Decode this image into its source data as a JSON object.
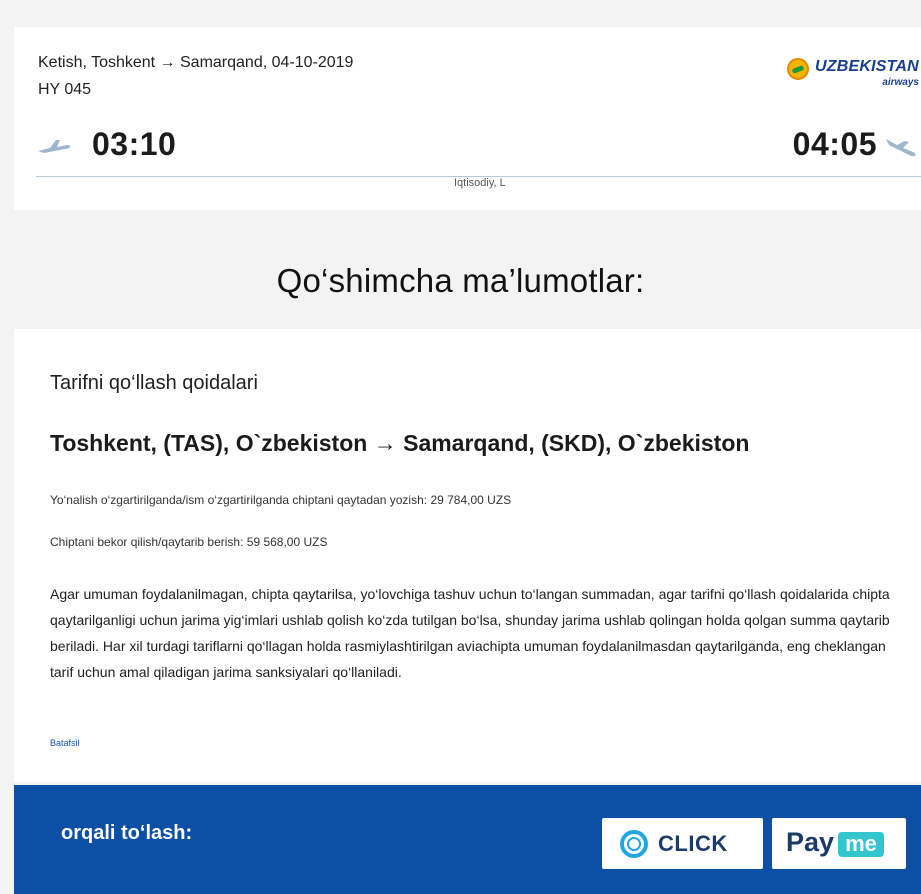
{
  "flight": {
    "route_title": "Ketish, Toshkent → Samarqand, 04-10-2019",
    "flight_number": "HY 045",
    "departure_time": "03:10",
    "arrival_time": "04:05",
    "fare_class": "Iqtisodiy, L",
    "airline": {
      "name": "UZBEKISTAN",
      "sub": "airways"
    }
  },
  "info": {
    "heading": "Qo‘shimcha ma’lumotlar:"
  },
  "rules": {
    "title": "Tarifni qo‘llash qoidalari",
    "route": "Toshkent, (TAS), O`zbekiston → Samarqand, (SKD), O`zbekiston",
    "change_fee": "Yo‘nalish o‘zgartirilganda/ism o‘zgartirilganda chiptani qaytadan yozish: 29 784,00 UZS",
    "cancel_fee": "Chiptani bekor qilish/qaytarib berish: 59 568,00 UZS",
    "paragraph": "Agar umuman foydalanilmagan, chipta qaytarilsa, yo‘lovchiga tashuv uchun to‘langan summadan, agar tarifni qo‘llash qoidalarida chipta qaytarilganligi uchun jarima yig‘imlari ushlab qolish ko‘zda tutilgan bo‘lsa, shunday jarima ushlab qolingan holda qolgan summa qaytarib beriladi. Har xil turdagi tariflarni qo‘llagan holda rasmiylashtirilgan aviachipta umuman foydalanilmasdan qaytarilganda, eng cheklangan tarif uchun amal qiladigan jarima sanksiyalari qo‘llaniladi.",
    "more_link": "Batafsil"
  },
  "payment": {
    "label": "orqali to‘lash:",
    "click_label": "CLICK",
    "payme_pay": "Pay",
    "payme_me": "me"
  },
  "colors": {
    "accent": "#0e4fa6",
    "airline_blue": "#1a3f91",
    "payme_teal": "#33c6cf",
    "click_blue": "#1b3c6b"
  }
}
